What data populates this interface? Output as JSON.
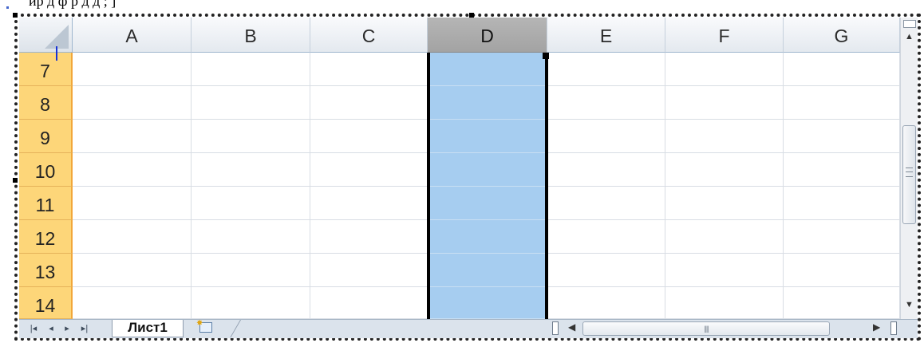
{
  "top_text": "ир                      д          ф р                                               д                               д             ;                  ]",
  "columns": [
    "A",
    "B",
    "C",
    "D",
    "E",
    "F",
    "G"
  ],
  "selected_column": "D",
  "rows": [
    "7",
    "8",
    "9",
    "10",
    "11",
    "12",
    "13",
    "14"
  ],
  "sheet_tab": "Лист1",
  "icons": {
    "nav_first": "first-sheet-icon",
    "nav_prev": "prev-sheet-icon",
    "nav_next": "next-sheet-icon",
    "nav_last": "last-sheet-icon",
    "new_sheet": "insert-sheet-icon",
    "scroll_up": "scroll-up-icon",
    "scroll_down": "scroll-down-icon",
    "scroll_left": "scroll-left-icon",
    "scroll_right": "scroll-right-icon"
  },
  "colors": {
    "selected_column_fill": "#a6cdf0",
    "row_header_fill": "#fdd679",
    "selected_header_fill": "#a9a9a9"
  }
}
